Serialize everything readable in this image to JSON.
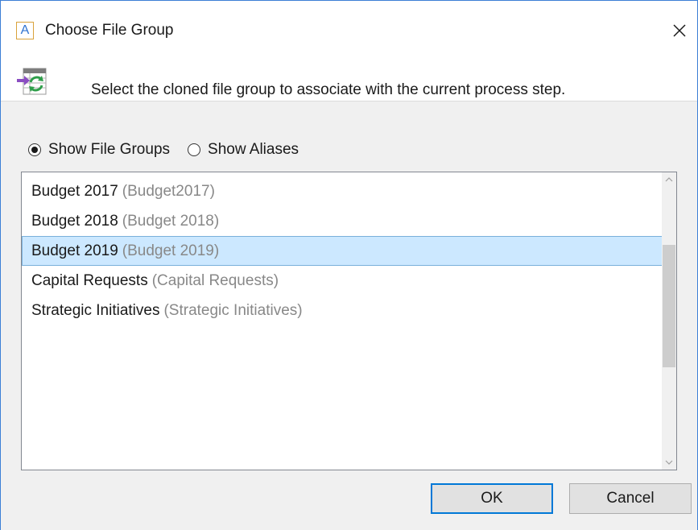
{
  "window": {
    "title": "Choose File Group",
    "app_icon_letter": "A",
    "close_glyph": "✕"
  },
  "header": {
    "instruction": "Select the cloned file group to associate with the current process step.",
    "icon": "process-step-icon"
  },
  "view_options": [
    {
      "label": "Show File Groups",
      "checked": true
    },
    {
      "label": "Show Aliases",
      "checked": false
    }
  ],
  "file_groups": [
    {
      "name": "Budget 2017",
      "alias": "(Budget2017)",
      "selected": false
    },
    {
      "name": "Budget 2018",
      "alias": "(Budget 2018)",
      "selected": false
    },
    {
      "name": "Budget 2019",
      "alias": "(Budget 2019)",
      "selected": true
    },
    {
      "name": "Capital Requests",
      "alias": "(Capital Requests)",
      "selected": false
    },
    {
      "name": "Strategic Initiatives",
      "alias": "(Strategic Initiatives)",
      "selected": false
    }
  ],
  "buttons": {
    "ok": "OK",
    "cancel": "Cancel"
  },
  "colors": {
    "selection_bg": "#cce8ff",
    "selection_border": "#7ab0db",
    "accent": "#0078d7",
    "alias_text": "#888888"
  }
}
